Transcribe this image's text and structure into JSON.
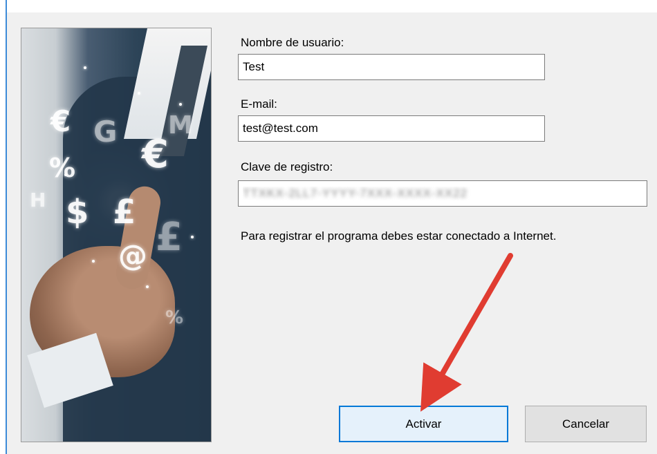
{
  "colors": {
    "accent": "#0078d7",
    "arrow": "#e03c31",
    "dialog_bg": "#f0f0f0"
  },
  "image": {
    "symbols": [
      "€",
      "G",
      "%",
      "H",
      "$",
      "£",
      "@",
      "€",
      "£",
      "M",
      "%"
    ]
  },
  "form": {
    "username_label": "Nombre de usuario:",
    "username_value": "Test",
    "email_label": "E-mail:",
    "email_value": "test@test.com",
    "key_label": "Clave de registro:",
    "key_value": "TTXKX-2LL7-YYYY-7XXX-XXXX-XX22",
    "info_text": "Para registrar el programa debes estar conectado a Internet."
  },
  "buttons": {
    "activate": "Activar",
    "cancel": "Cancelar"
  }
}
